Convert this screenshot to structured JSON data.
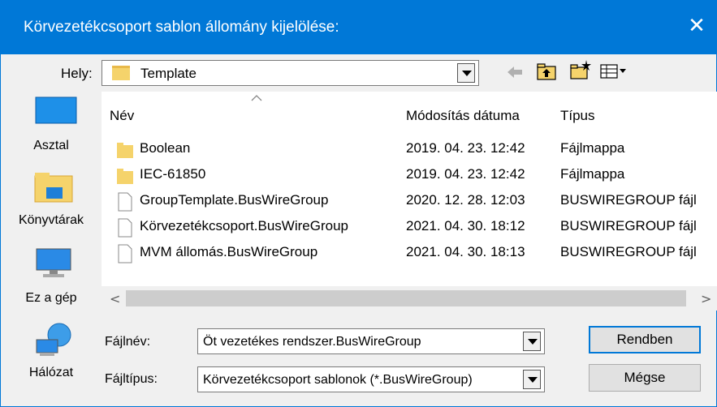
{
  "dialog": {
    "title": "Körvezetékcsoport sablon állomány kijelölése:",
    "close_glyph": "✕"
  },
  "location": {
    "label": "Hely:",
    "value": "Template"
  },
  "places": [
    {
      "label": "Asztal",
      "icon": "desktop-icon"
    },
    {
      "label": "Könyvtárak",
      "icon": "libraries-icon"
    },
    {
      "label": "Ez a gép",
      "icon": "computer-icon"
    },
    {
      "label": "Hálózat",
      "icon": "network-icon"
    }
  ],
  "columns": {
    "name": "Név",
    "modified": "Módosítás dátuma",
    "type": "Típus"
  },
  "files": [
    {
      "name": "Boolean",
      "date": "2019. 04. 23. 12:42",
      "type": "Fájlmappa",
      "icon": "folder-icon"
    },
    {
      "name": "IEC-61850",
      "date": "2019. 04. 23. 12:42",
      "type": "Fájlmappa",
      "icon": "folder-icon"
    },
    {
      "name": "GroupTemplate.BusWireGroup",
      "date": "2020. 12. 28. 12:03",
      "type": "BUSWIREGROUP fájl",
      "icon": "file-icon"
    },
    {
      "name": "Körvezetékcsoport.BusWireGroup",
      "date": "2021. 04. 30. 18:12",
      "type": "BUSWIREGROUP fájl",
      "icon": "file-icon"
    },
    {
      "name": "MVM állomás.BusWireGroup",
      "date": "2021. 04. 30. 18:13",
      "type": "BUSWIREGROUP fájl",
      "icon": "file-icon"
    }
  ],
  "filename": {
    "label": "Fájlnév:",
    "value": "Öt vezetékes rendszer.BusWireGroup"
  },
  "filetype": {
    "label": "Fájltípus:",
    "value": "Körvezetékcsoport sablonok (*.BusWireGroup)"
  },
  "buttons": {
    "ok": "Rendben",
    "cancel": "Mégse"
  },
  "scroll": {
    "left": "<",
    "right": ">"
  },
  "colors": {
    "accent": "#0078d7",
    "folder": "#f5d36b"
  }
}
